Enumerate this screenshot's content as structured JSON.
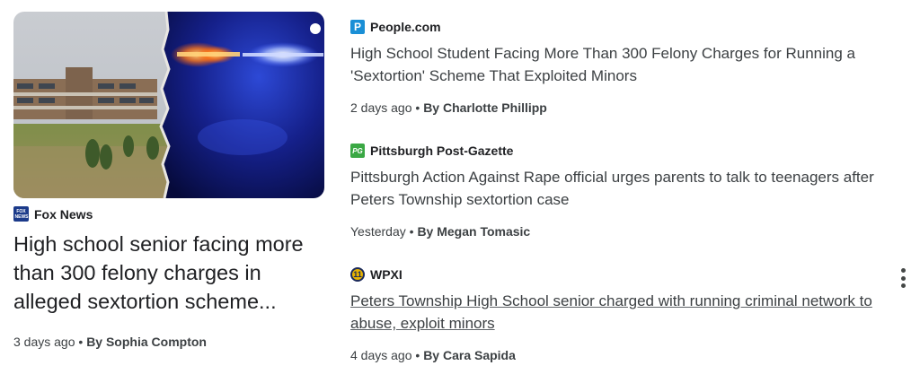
{
  "main_card": {
    "source": "Fox News",
    "source_logo_text": "FOX NEWS",
    "title": "High school senior facing more than 300 felony charges in alleged sextortion scheme...",
    "time": "3 days ago",
    "separator": "•",
    "author": "By Sophia Compton"
  },
  "articles": [
    {
      "source": "People.com",
      "logo_text": "P",
      "logo_color": "#1a8fd6",
      "title": "High School Student Facing More Than 300 Felony Charges for Running a 'Sextortion' Scheme That Exploited Minors",
      "time": "2 days ago",
      "separator": "•",
      "author": "By Charlotte Phillipp"
    },
    {
      "source": "Pittsburgh Post-Gazette",
      "logo_text": "PG",
      "logo_color": "#3aa844",
      "title": "Pittsburgh Action Against Rape official urges parents to talk to teenagers after Peters Township sextortion case",
      "time": "Yesterday",
      "separator": "•",
      "author": "By Megan Tomasic"
    },
    {
      "source": "WPXI",
      "logo_text": "11",
      "logo_color": "#e8b400",
      "title": "Peters Township High School senior charged with running criminal network to abuse, exploit minors",
      "time": "4 days ago",
      "separator": "•",
      "author": "By Cara Sapida"
    }
  ],
  "icons": {
    "more": "more-vert-icon"
  }
}
